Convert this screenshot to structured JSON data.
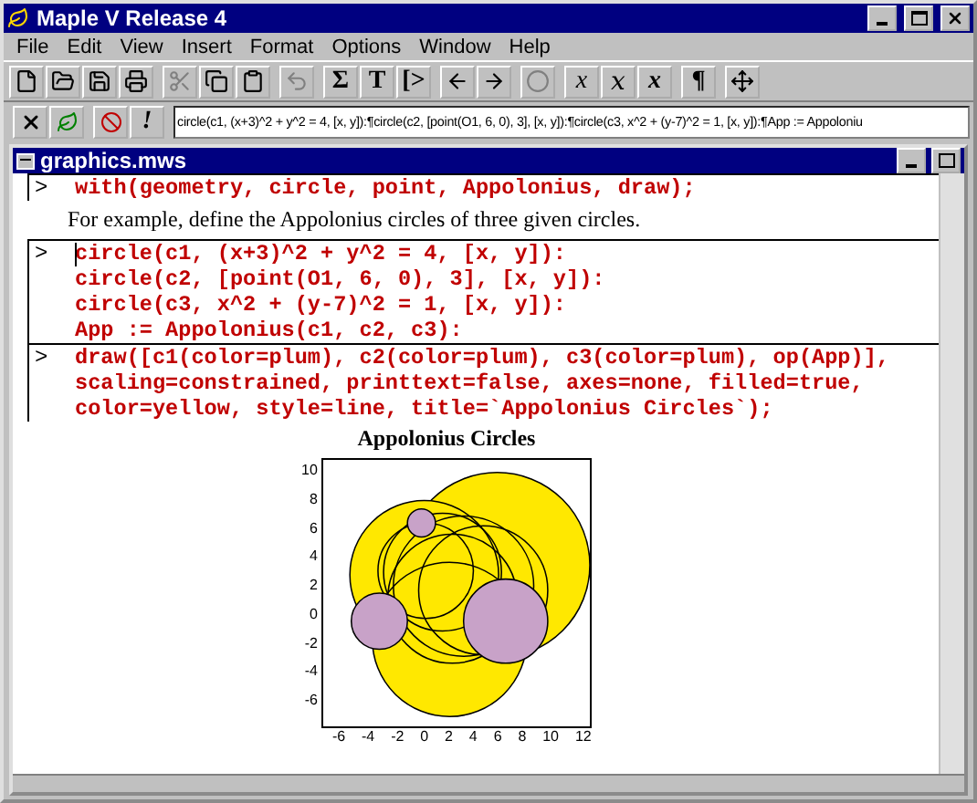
{
  "window": {
    "title": "Maple V Release 4"
  },
  "menu": [
    {
      "label": "File"
    },
    {
      "label": "Edit"
    },
    {
      "label": "View"
    },
    {
      "label": "Insert"
    },
    {
      "label": "Format"
    },
    {
      "label": "Options"
    },
    {
      "label": "Window"
    },
    {
      "label": "Help"
    }
  ],
  "toolbar": [
    [
      {
        "disabled": false
      },
      {
        "disabled": false
      },
      {
        "disabled": false
      },
      {
        "disabled": false
      }
    ],
    [
      {
        "disabled": true
      },
      {
        "disabled": false
      },
      {
        "disabled": false
      }
    ],
    [
      {
        "disabled": true
      }
    ],
    [
      {
        "label": "Σ",
        "disabled": false
      },
      {
        "label": "T",
        "disabled": false
      },
      {
        "label": "[>",
        "disabled": false
      }
    ],
    [
      {
        "disabled": false
      },
      {
        "disabled": false
      }
    ],
    [
      {
        "disabled": true
      }
    ],
    [
      {
        "label": "x",
        "kind": "plain",
        "disabled": false
      },
      {
        "label": "x",
        "kind": "script",
        "disabled": false
      },
      {
        "label": "x",
        "kind": "bold",
        "disabled": false
      }
    ],
    [
      {
        "label": "¶",
        "disabled": false
      }
    ],
    [
      {
        "disabled": false
      }
    ]
  ],
  "input_bar": {
    "bang": "!",
    "value": "circle(c1, (x+3)^2 + y^2 = 4, [x, y]):¶circle(c2, [point(O1, 6, 0), 3], [x, y]):¶circle(c3, x^2 + (y-7)^2 = 1, [x, y]):¶App := Appoloniu"
  },
  "document": {
    "title": "graphics.mws",
    "cut_prompt": ">",
    "cut_line": "with(geometry, circle, point, Appolonius, draw);",
    "paragraph": "For example, define the Appolonius circles of three given circles.",
    "groups": [
      {
        "prompt": ">",
        "cursor": true,
        "lines": [
          "circle(c1, (x+3)^2 + y^2 = 4, [x, y]):",
          "circle(c2, [point(O1, 6, 0), 3], [x, y]):",
          "circle(c3, x^2 + (y-7)^2 = 1, [x, y]):",
          "App := Appolonius(c1, c2, c3):"
        ]
      },
      {
        "prompt": ">",
        "lines": [
          "draw([c1(color=plum), c2(color=plum), c3(color=plum), op(App)],",
          "scaling=constrained, printtext=false, axes=none, filled=true,",
          "color=yellow, style=line, title=`Appolonius Circles`);"
        ]
      }
    ],
    "plot": {
      "title": "Appolonius Circles",
      "x_ticks": [
        "-6",
        "-4",
        "-2",
        "0",
        "2",
        "4",
        "6",
        "8",
        "10",
        "12"
      ],
      "y_ticks": [
        "10",
        "8",
        "6",
        "4",
        "2",
        "0",
        "-2",
        "-4",
        "-6"
      ]
    }
  }
}
